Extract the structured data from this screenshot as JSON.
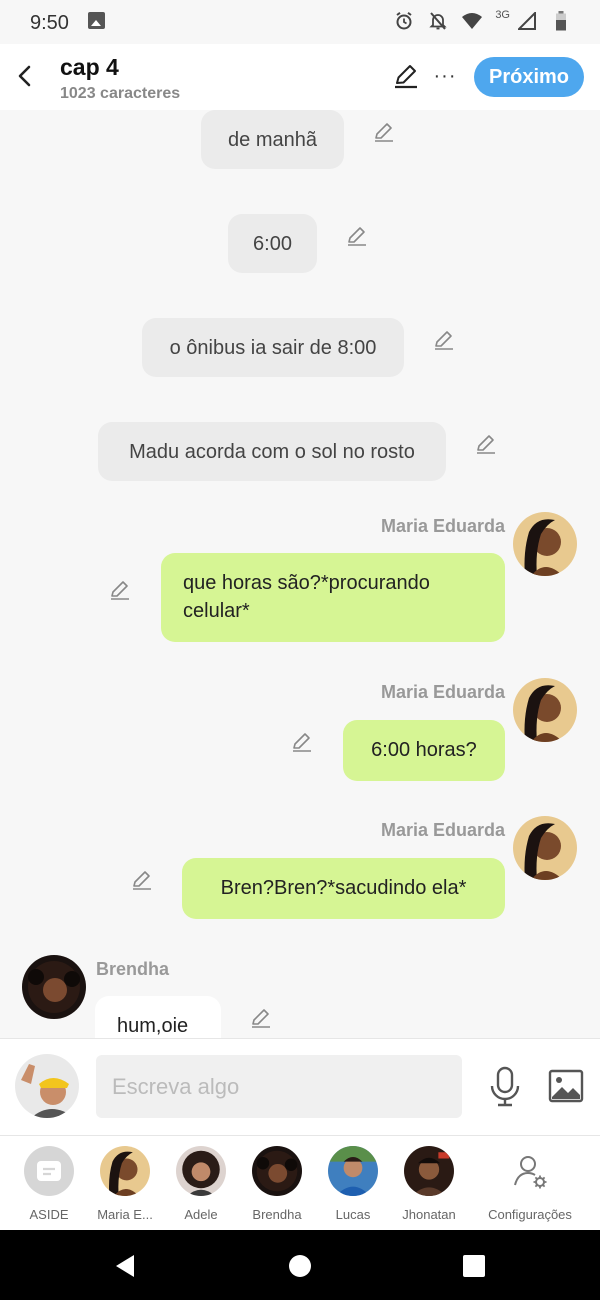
{
  "status": {
    "time": "9:50",
    "network": "3G"
  },
  "header": {
    "title": "cap 4",
    "subtitle": "1023 caracteres",
    "next_label": "Próximo"
  },
  "messages": [
    {
      "type": "narration",
      "text": "de manhã"
    },
    {
      "type": "narration",
      "text": "6:00"
    },
    {
      "type": "narration",
      "text": "o ônibus ia sair de 8:00"
    },
    {
      "type": "narration",
      "text": "Madu acorda com o sol no rosto"
    },
    {
      "type": "right",
      "speaker": "Maria Eduarda",
      "text": "que horas são?*procurando celular*"
    },
    {
      "type": "right",
      "speaker": "Maria Eduarda",
      "text": "6:00 horas?"
    },
    {
      "type": "right",
      "speaker": "Maria Eduarda",
      "text": "Bren?Bren?*sacudindo ela*"
    },
    {
      "type": "left",
      "speaker": "Brendha",
      "text": "hum,oie"
    }
  ],
  "input": {
    "placeholder": "Escreva algo"
  },
  "characters": [
    {
      "label": "ASIDE",
      "icon": "aside-icon"
    },
    {
      "label": "Maria E..."
    },
    {
      "label": "Adele"
    },
    {
      "label": "Brendha"
    },
    {
      "label": "Lucas"
    },
    {
      "label": "Jhonatan"
    },
    {
      "label": "Configurações",
      "icon": "user-settings-icon"
    }
  ],
  "colors": {
    "accent": "#4ea7ee",
    "right_bubble": "#d6f594",
    "narration_bubble": "#ebebeb",
    "nav_bar": "#000000"
  }
}
